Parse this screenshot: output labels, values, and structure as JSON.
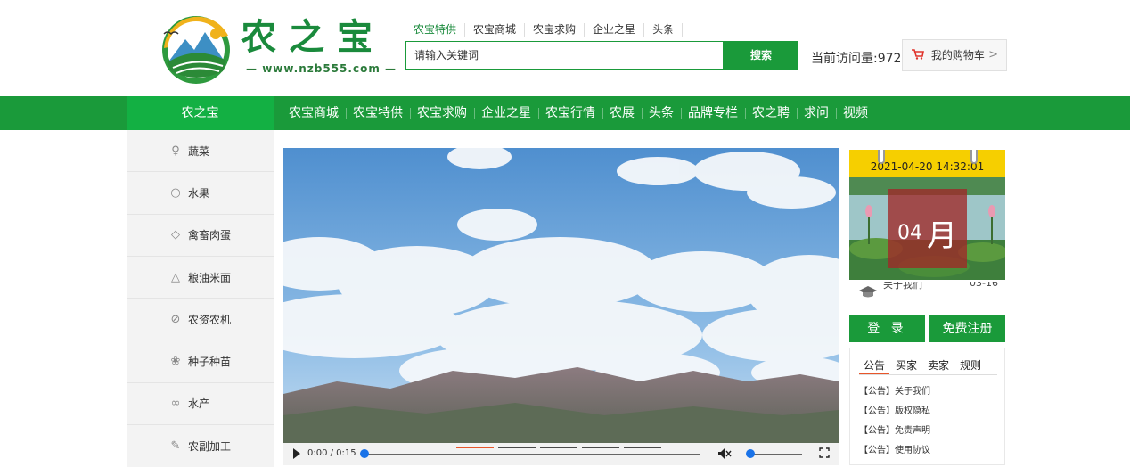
{
  "logo": {
    "text": "农之宝",
    "url": "www.nzb555.com"
  },
  "top_links": [
    "农宝特供",
    "农宝商城",
    "农宝求购",
    "企业之星",
    "头条"
  ],
  "search": {
    "placeholder": "请输入关键词",
    "button": "搜索"
  },
  "visits": "当前访问量:972",
  "cart": {
    "icon": "cart-icon",
    "label": "我的购物车",
    "arrow": ">"
  },
  "nav": {
    "home": "农之宝",
    "items": [
      "农宝商城",
      "农宝特供",
      "农宝求购",
      "企业之星",
      "农宝行情",
      "农展",
      "头条",
      "品牌专栏",
      "农之聘",
      "求问",
      "视频"
    ]
  },
  "sidebar": {
    "items": [
      {
        "label": "蔬菜",
        "icon": "vegetable-icon"
      },
      {
        "label": "水果",
        "icon": "fruit-icon"
      },
      {
        "label": "禽畜肉蛋",
        "icon": "meat-icon"
      },
      {
        "label": "粮油米面",
        "icon": "grain-bag-icon"
      },
      {
        "label": "农资农机",
        "icon": "tool-icon"
      },
      {
        "label": "种子种苗",
        "icon": "seed-icon"
      },
      {
        "label": "水产",
        "icon": "fish-icon"
      },
      {
        "label": "农副加工",
        "icon": "brush-icon"
      }
    ]
  },
  "video": {
    "time": "0:00 / 0:15",
    "progress": 0,
    "volume": 0,
    "muted": true
  },
  "calendar": {
    "datetime": "2021-04-20 14:32:01",
    "month_num": "04",
    "month_unit": "月"
  },
  "under_strip": {
    "left": "关于我们",
    "right": "03-16"
  },
  "auth": {
    "login": "登 录",
    "register": "免费注册"
  },
  "notice": {
    "tabs": [
      "公告",
      "买家",
      "卖家",
      "规则"
    ],
    "active_tab": "公告",
    "items": [
      "【公告】关于我们",
      "【公告】版权隐私",
      "【公告】免责声明",
      "【公告】使用协议"
    ]
  },
  "colors": {
    "brand_green": "#1a9a3a",
    "nav_home_green": "#13b043",
    "calendar_yellow": "#f6cf00",
    "accent_orange": "#e8562a"
  }
}
